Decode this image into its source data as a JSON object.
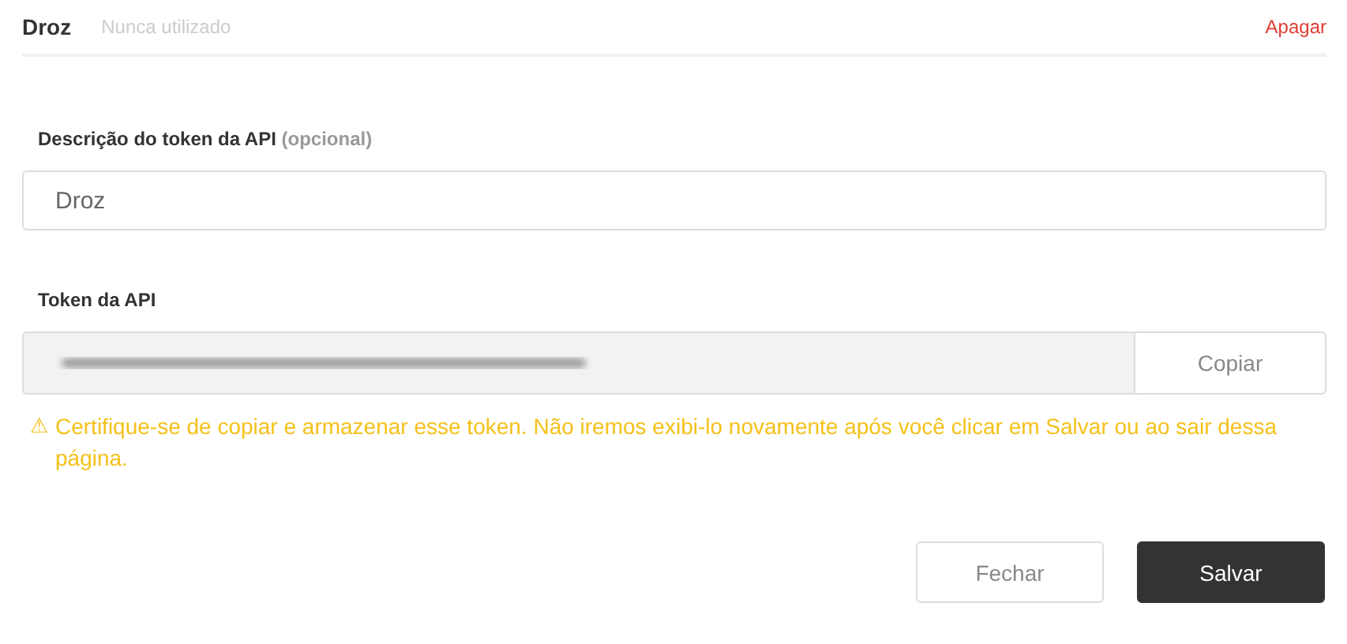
{
  "header": {
    "name": "Droz",
    "status": "Nunca utilizado",
    "delete_link": "Apagar"
  },
  "description_field": {
    "label": "Descrição do token da API **(opcional)**",
    "value": "Droz"
  },
  "token_field": {
    "label": "Token da API",
    "redacted": true,
    "copy_button": "Copiar"
  },
  "warning": {
    "icon": "⚠",
    "text": "Certifique-se de copiar e armazenar esse token. Não iremos exibi-lo novamente após você clicar em Salvar ou ao sair dessa página."
  },
  "buttons": [
    {
      "label": "Fechar",
      "kind": "secondary"
    },
    {
      "label": "Salvar",
      "kind": "primary"
    }
  ]
}
